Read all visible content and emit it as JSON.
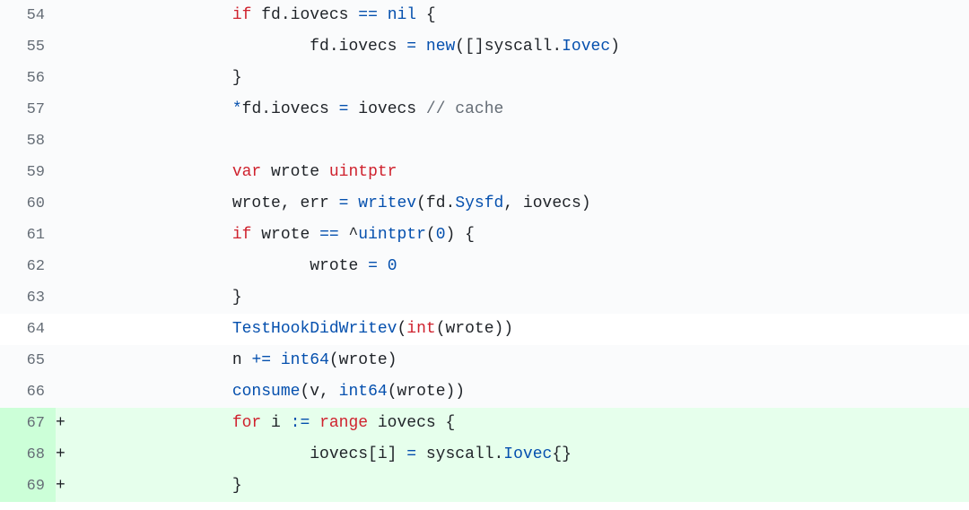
{
  "lines": [
    {
      "num": "54",
      "marker": "",
      "type": "context",
      "tokens": [
        {
          "t": "                ",
          "c": ""
        },
        {
          "t": "if",
          "c": "tok-keyword"
        },
        {
          "t": " fd.iovecs ",
          "c": ""
        },
        {
          "t": "==",
          "c": "tok-operator"
        },
        {
          "t": " ",
          "c": ""
        },
        {
          "t": "nil",
          "c": "tok-blue"
        },
        {
          "t": " {",
          "c": ""
        }
      ]
    },
    {
      "num": "55",
      "marker": "",
      "type": "context",
      "tokens": [
        {
          "t": "                        fd.iovecs ",
          "c": ""
        },
        {
          "t": "=",
          "c": "tok-operator"
        },
        {
          "t": " ",
          "c": ""
        },
        {
          "t": "new",
          "c": "tok-blue"
        },
        {
          "t": "([]syscall.",
          "c": ""
        },
        {
          "t": "Iovec",
          "c": "tok-blue"
        },
        {
          "t": ")",
          "c": ""
        }
      ]
    },
    {
      "num": "56",
      "marker": "",
      "type": "context",
      "tokens": [
        {
          "t": "                }",
          "c": ""
        }
      ]
    },
    {
      "num": "57",
      "marker": "",
      "type": "context",
      "tokens": [
        {
          "t": "                ",
          "c": ""
        },
        {
          "t": "*",
          "c": "tok-operator"
        },
        {
          "t": "fd.iovecs ",
          "c": ""
        },
        {
          "t": "=",
          "c": "tok-operator"
        },
        {
          "t": " iovecs ",
          "c": ""
        },
        {
          "t": "// cache",
          "c": "tok-comment"
        }
      ]
    },
    {
      "num": "58",
      "marker": "",
      "type": "context",
      "tokens": []
    },
    {
      "num": "59",
      "marker": "",
      "type": "context",
      "tokens": [
        {
          "t": "                ",
          "c": ""
        },
        {
          "t": "var",
          "c": "tok-keyword"
        },
        {
          "t": " wrote ",
          "c": ""
        },
        {
          "t": "uintptr",
          "c": "tok-builtin"
        }
      ]
    },
    {
      "num": "60",
      "marker": "",
      "type": "context",
      "tokens": [
        {
          "t": "                wrote, err ",
          "c": ""
        },
        {
          "t": "=",
          "c": "tok-operator"
        },
        {
          "t": " ",
          "c": ""
        },
        {
          "t": "writev",
          "c": "tok-blue"
        },
        {
          "t": "(fd.",
          "c": ""
        },
        {
          "t": "Sysfd",
          "c": "tok-blue"
        },
        {
          "t": ", iovecs)",
          "c": ""
        }
      ]
    },
    {
      "num": "61",
      "marker": "",
      "type": "context",
      "tokens": [
        {
          "t": "                ",
          "c": ""
        },
        {
          "t": "if",
          "c": "tok-keyword"
        },
        {
          "t": " wrote ",
          "c": ""
        },
        {
          "t": "==",
          "c": "tok-operator"
        },
        {
          "t": " ^",
          "c": ""
        },
        {
          "t": "uintptr",
          "c": "tok-blue"
        },
        {
          "t": "(",
          "c": ""
        },
        {
          "t": "0",
          "c": "tok-number"
        },
        {
          "t": ") {",
          "c": ""
        }
      ]
    },
    {
      "num": "62",
      "marker": "",
      "type": "context",
      "tokens": [
        {
          "t": "                        wrote ",
          "c": ""
        },
        {
          "t": "=",
          "c": "tok-operator"
        },
        {
          "t": " ",
          "c": ""
        },
        {
          "t": "0",
          "c": "tok-number"
        }
      ]
    },
    {
      "num": "63",
      "marker": "",
      "type": "context",
      "tokens": [
        {
          "t": "                }",
          "c": ""
        }
      ]
    },
    {
      "num": "64",
      "marker": "",
      "type": "context white",
      "tokens": [
        {
          "t": "                ",
          "c": ""
        },
        {
          "t": "TestHookDidWritev",
          "c": "tok-blue"
        },
        {
          "t": "(",
          "c": ""
        },
        {
          "t": "int",
          "c": "tok-builtin"
        },
        {
          "t": "(wrote))",
          "c": ""
        }
      ]
    },
    {
      "num": "65",
      "marker": "",
      "type": "context",
      "tokens": [
        {
          "t": "                n ",
          "c": ""
        },
        {
          "t": "+=",
          "c": "tok-operator"
        },
        {
          "t": " ",
          "c": ""
        },
        {
          "t": "int64",
          "c": "tok-blue"
        },
        {
          "t": "(wrote)",
          "c": ""
        }
      ]
    },
    {
      "num": "66",
      "marker": "",
      "type": "context",
      "tokens": [
        {
          "t": "                ",
          "c": ""
        },
        {
          "t": "consume",
          "c": "tok-blue"
        },
        {
          "t": "(v, ",
          "c": ""
        },
        {
          "t": "int64",
          "c": "tok-blue"
        },
        {
          "t": "(wrote))",
          "c": ""
        }
      ]
    },
    {
      "num": "67",
      "marker": "+",
      "type": "addition",
      "tokens": [
        {
          "t": "                ",
          "c": ""
        },
        {
          "t": "for",
          "c": "tok-keyword"
        },
        {
          "t": " i ",
          "c": ""
        },
        {
          "t": ":=",
          "c": "tok-operator"
        },
        {
          "t": " ",
          "c": ""
        },
        {
          "t": "range",
          "c": "tok-keyword"
        },
        {
          "t": " iovecs {",
          "c": ""
        }
      ]
    },
    {
      "num": "68",
      "marker": "+",
      "type": "addition",
      "tokens": [
        {
          "t": "                        iovecs[i] ",
          "c": ""
        },
        {
          "t": "=",
          "c": "tok-operator"
        },
        {
          "t": " syscall.",
          "c": ""
        },
        {
          "t": "Iovec",
          "c": "tok-blue"
        },
        {
          "t": "{}",
          "c": ""
        }
      ]
    },
    {
      "num": "69",
      "marker": "+",
      "type": "addition",
      "tokens": [
        {
          "t": "                }",
          "c": ""
        }
      ]
    }
  ]
}
